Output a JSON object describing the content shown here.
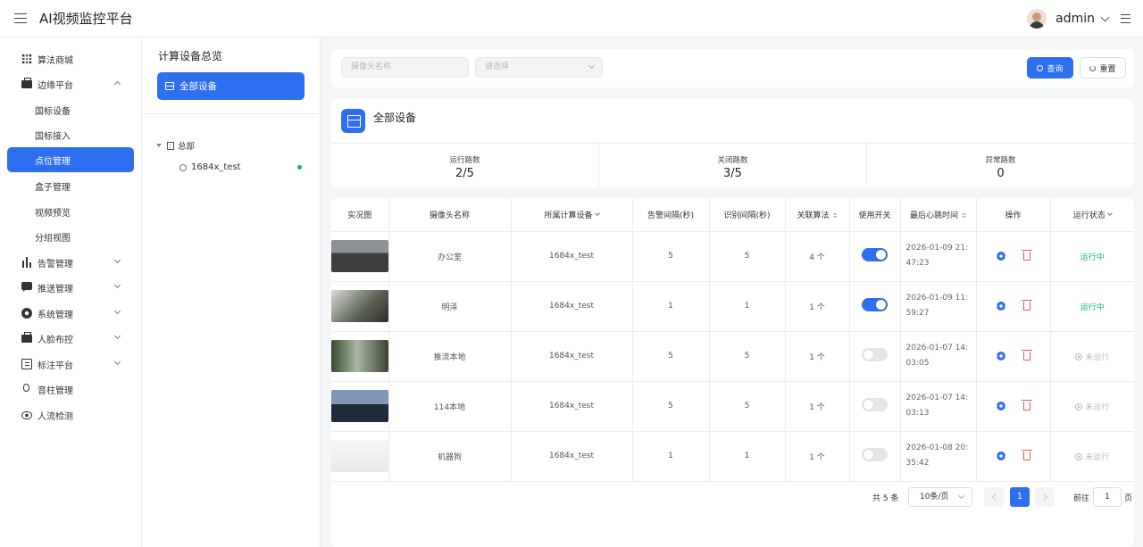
{
  "header": {
    "title": "AI视频监控平台",
    "username": "admin"
  },
  "sidebar": {
    "items": [
      {
        "label": "算法商城",
        "icon": "grid-icon"
      },
      {
        "label": "边缘平台",
        "icon": "briefcase-icon",
        "expanded": true
      },
      {
        "label": "国标设备"
      },
      {
        "label": "国标接入"
      },
      {
        "label": "点位管理",
        "active": true
      },
      {
        "label": "盒子管理"
      },
      {
        "label": "视频预览"
      },
      {
        "label": "分组视图"
      },
      {
        "label": "告警管理",
        "icon": "bar-chart-icon"
      },
      {
        "label": "推送管理",
        "icon": "message-icon"
      },
      {
        "label": "系统管理",
        "icon": "gear-icon"
      },
      {
        "label": "人脸布控",
        "icon": "briefcase-icon"
      },
      {
        "label": "标注平台",
        "icon": "clipboard-icon"
      },
      {
        "label": "音柱管理",
        "icon": "microphone-icon"
      },
      {
        "label": "人流检测",
        "icon": "eye-icon"
      }
    ]
  },
  "tree": {
    "title": "计算设备总览",
    "all_label": "全部设备",
    "root_label": "总部",
    "child_label": "1684x_test"
  },
  "filter": {
    "camera_placeholder": "摄像头名称",
    "select_placeholder": "请选择",
    "query_label": "查询",
    "reset_label": "重置"
  },
  "summary": {
    "title": "全部设备",
    "stats": [
      {
        "label": "运行路数",
        "value": "2/5"
      },
      {
        "label": "关闭路数",
        "value": "3/5"
      },
      {
        "label": "异常路数",
        "value": "0"
      }
    ]
  },
  "table": {
    "columns": [
      "实况图",
      "摄像头名称",
      "所属计算设备",
      "告警间隔(秒)",
      "识别间隔(秒)",
      "关联算法",
      "使用开关",
      "最后心跳时间",
      "操作",
      "运行状态"
    ],
    "rows": [
      {
        "name": "办公室",
        "device": "1684x_test",
        "alarm": "5",
        "recog": "5",
        "algo": "4 个",
        "enabled": true,
        "heartbeat": "2026-01-09 21:47:23",
        "status": "运行中",
        "running": true
      },
      {
        "name": "明泽",
        "device": "1684x_test",
        "alarm": "1",
        "recog": "1",
        "algo": "1 个",
        "enabled": true,
        "heartbeat": "2026-01-09 11:59:27",
        "status": "运行中",
        "running": true
      },
      {
        "name": "推流本地",
        "device": "1684x_test",
        "alarm": "5",
        "recog": "5",
        "algo": "1 个",
        "enabled": false,
        "heartbeat": "2026-01-07 14:03:05",
        "status": "未运行",
        "running": false
      },
      {
        "name": "114本地",
        "device": "1684x_test",
        "alarm": "5",
        "recog": "5",
        "algo": "1 个",
        "enabled": false,
        "heartbeat": "2026-01-07 14:03:13",
        "status": "未运行",
        "running": false
      },
      {
        "name": "机器狗",
        "device": "1684x_test",
        "alarm": "1",
        "recog": "1",
        "algo": "1 个",
        "enabled": false,
        "heartbeat": "2026-01-08 20:35:42",
        "status": "未运行",
        "running": false
      }
    ]
  },
  "pagination": {
    "total": "共 5 条",
    "page_size": "10条/页",
    "current": "1",
    "goto_label": "前往",
    "goto_value": "1",
    "unit": "页"
  },
  "colors": {
    "accent": "#2e6ff0",
    "running": "#19b36b",
    "danger": "#f05454"
  }
}
